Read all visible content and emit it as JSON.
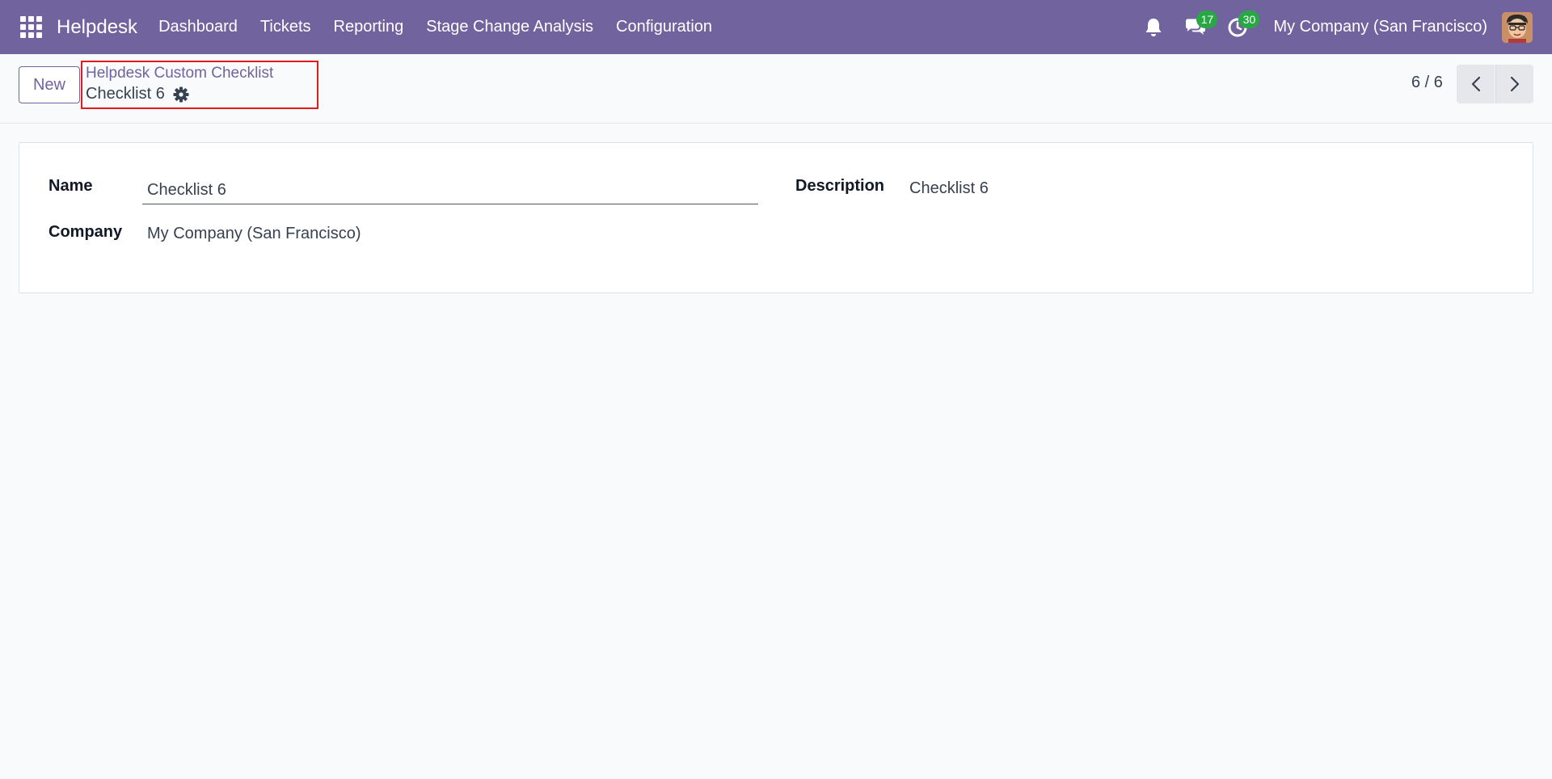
{
  "navbar": {
    "brand": "Helpdesk",
    "menu": [
      "Dashboard",
      "Tickets",
      "Reporting",
      "Stage Change Analysis",
      "Configuration"
    ],
    "messages_count": "17",
    "activities_count": "30",
    "company": "My Company (San Francisco)",
    "color": "#71639e"
  },
  "control_panel": {
    "new_label": "New",
    "breadcrumb_parent": "Helpdesk Custom Checklist",
    "breadcrumb_current": "Checklist 6",
    "pager": "6 / 6"
  },
  "form": {
    "name_label": "Name",
    "name_value": "Checklist 6",
    "company_label": "Company",
    "company_value": "My Company (San Francisco)",
    "description_label": "Description",
    "description_value": "Checklist 6"
  },
  "icons": {
    "apps": "grid-icon",
    "notifications": "bell-icon",
    "messages": "chat-icon",
    "activities": "clock-icon",
    "actions": "gear-icon",
    "prev": "chevron-left-icon",
    "next": "chevron-right-icon"
  }
}
